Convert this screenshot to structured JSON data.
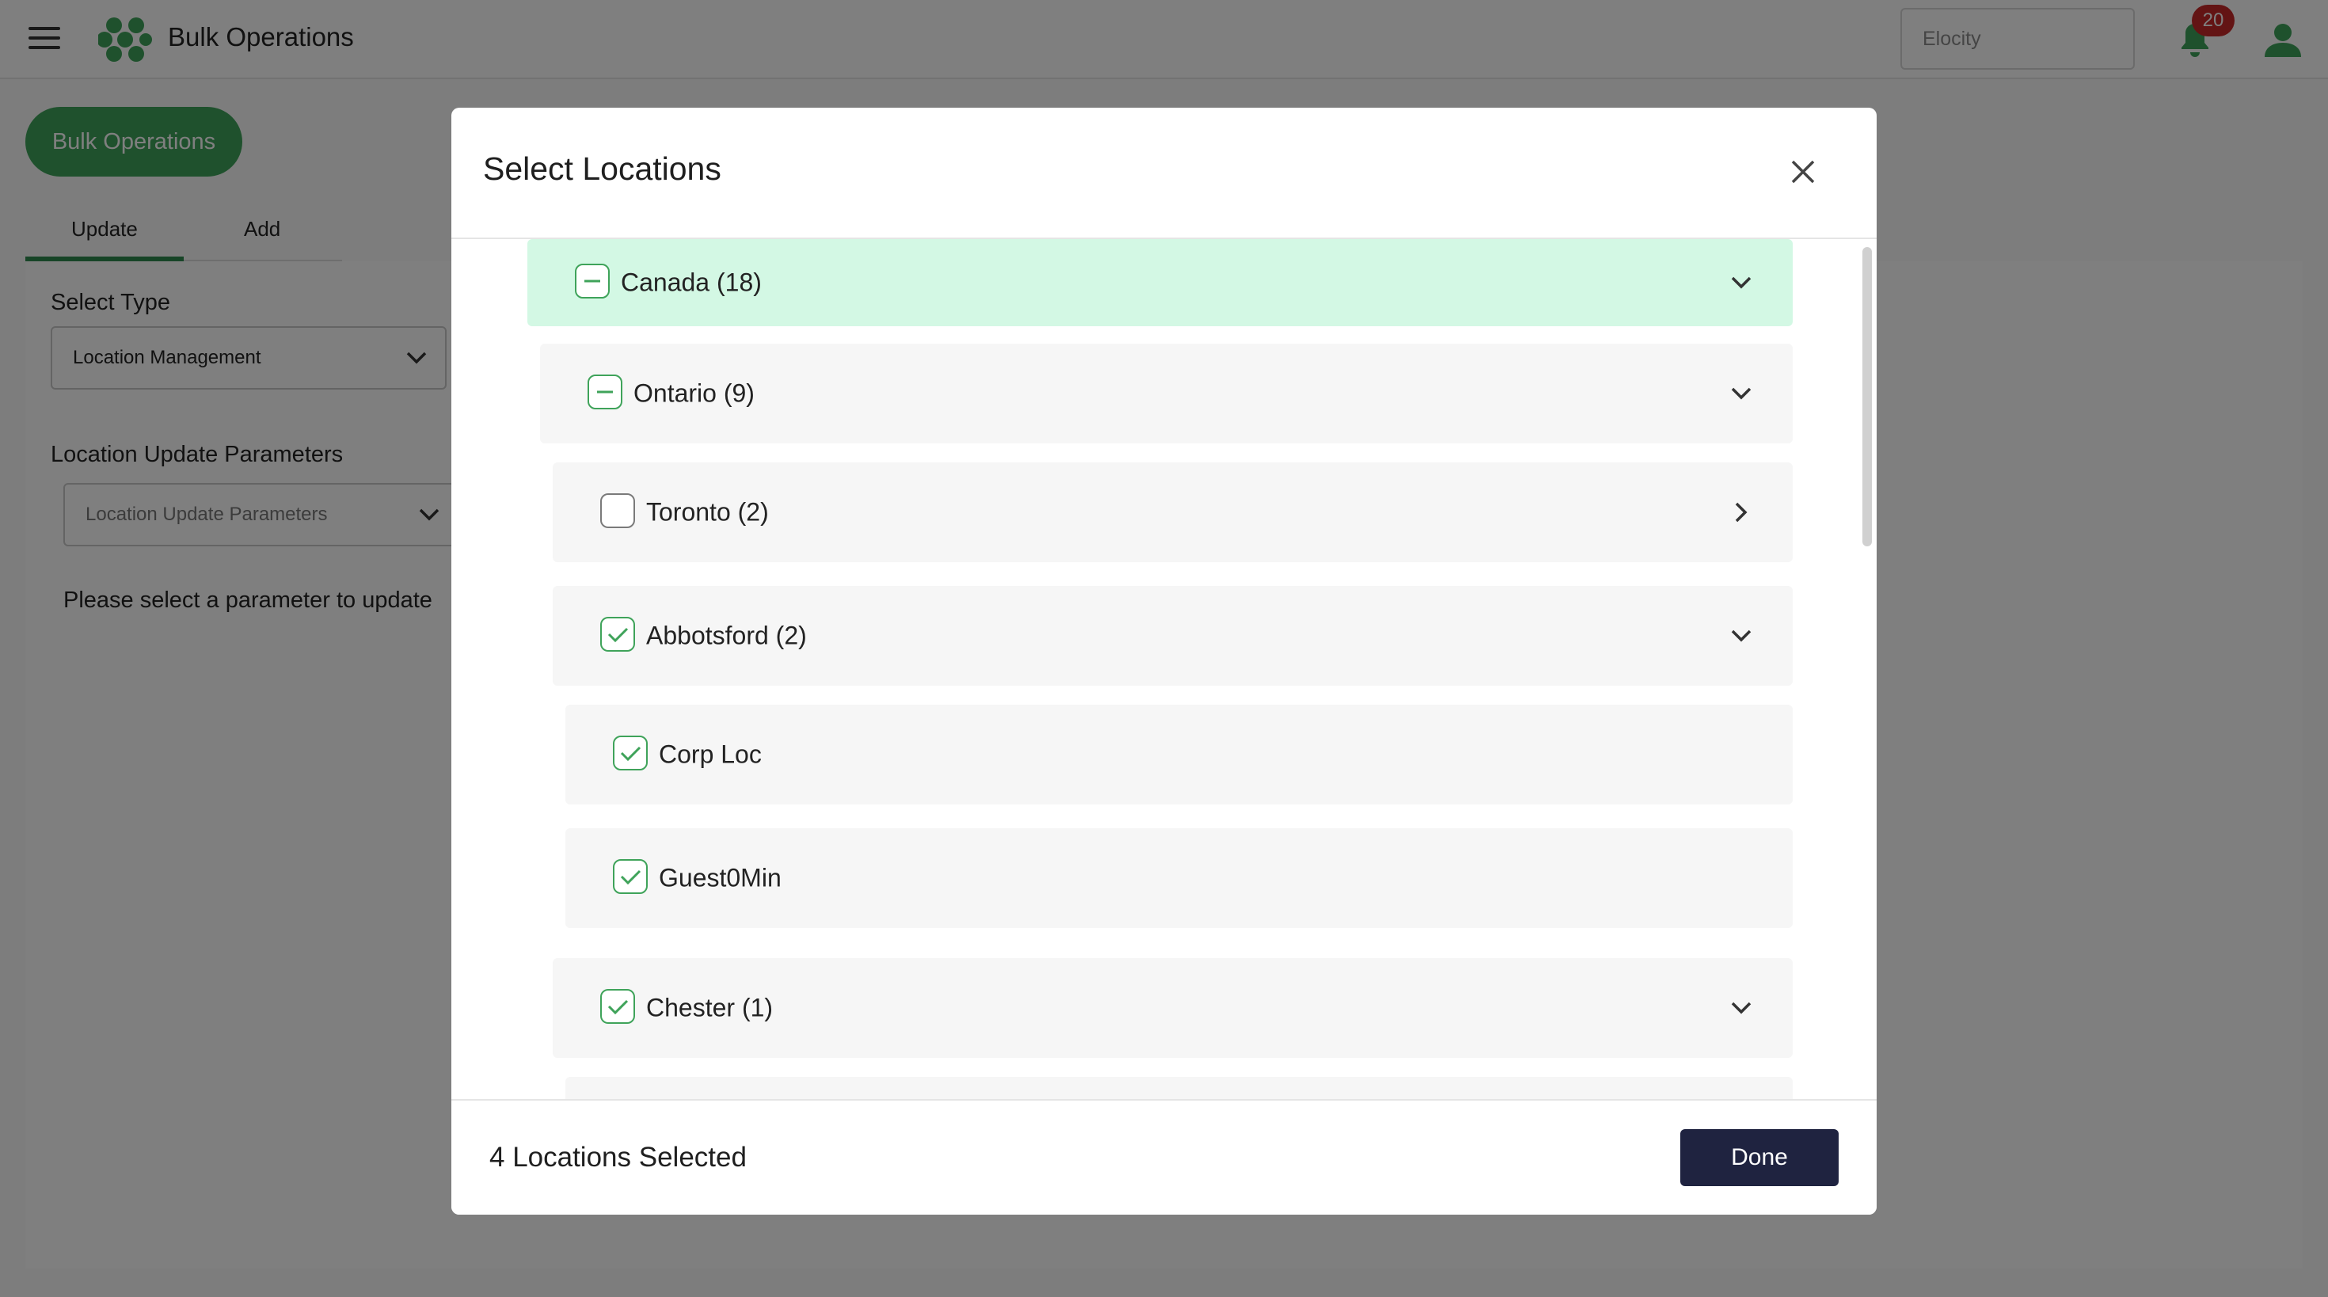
{
  "header": {
    "app_title": "Bulk Operations",
    "org_placeholder": "Elocity",
    "notification_count": "20",
    "brand_color": "#3fa35a"
  },
  "background": {
    "primary_button": "Bulk Operations",
    "tabs": [
      {
        "label": "Update",
        "active": true
      },
      {
        "label": "Add",
        "active": false
      }
    ],
    "select_type_label": "Select Type",
    "select_type_value": "Location Management",
    "params_label": "Location Update Parameters",
    "params_placeholder": "Location Update Parameters",
    "hint": "Please select a parameter to update"
  },
  "modal": {
    "title": "Select Locations",
    "tree": [
      {
        "label": "Canada (18)",
        "state": "partial",
        "expand": "expanded",
        "level": 0
      },
      {
        "label": "Ontario (9)",
        "state": "partial",
        "expand": "expanded",
        "level": 1
      },
      {
        "label": "Toronto (2)",
        "state": "unchecked",
        "expand": "collapsed",
        "level": 2
      },
      {
        "label": "Abbotsford (2)",
        "state": "checked",
        "expand": "expanded",
        "level": 2
      },
      {
        "label": "Corp Loc",
        "state": "checked",
        "expand": "none",
        "level": 3
      },
      {
        "label": "Guest0Min",
        "state": "checked",
        "expand": "none",
        "level": 3
      },
      {
        "label": "Chester (1)",
        "state": "checked",
        "expand": "expanded",
        "level": 2
      }
    ],
    "footer": {
      "selected_text": "4 Locations Selected",
      "done_label": "Done"
    }
  }
}
